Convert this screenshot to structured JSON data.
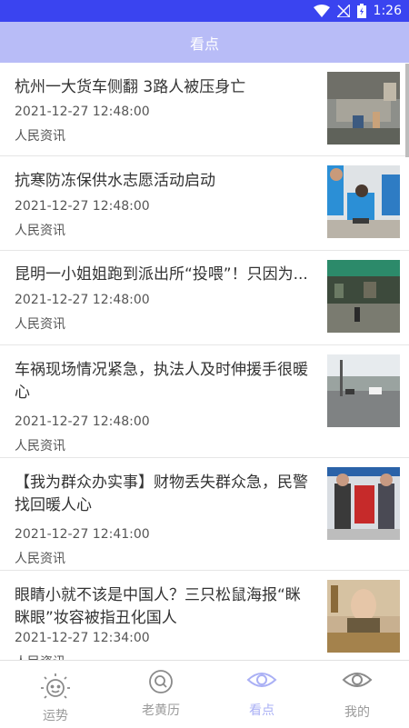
{
  "status_bar": {
    "time": "1:26",
    "icons": [
      "wifi-icon",
      "no-signal-icon",
      "battery-icon"
    ]
  },
  "app_bar": {
    "title": "看点"
  },
  "news": [
    {
      "title": "杭州一大货车侧翻 3路人被压身亡",
      "time": "2021-12-27 12:48:00",
      "source": "人民资讯",
      "thumb": "accident-photo"
    },
    {
      "title": "抗寒防冻保供水志愿活动启动",
      "time": "2021-12-27 12:48:00",
      "source": "人民资讯",
      "thumb": "volunteers-photo"
    },
    {
      "title": "昆明一小姐姐跑到派出所“投喂”！只因为...",
      "time": "2021-12-27 12:48:00",
      "source": "人民资讯",
      "thumb": "police-station-photo"
    },
    {
      "title": "车祸现场情况紧急，执法人及时伸援手很暖心",
      "time": "2021-12-27 12:48:00",
      "source": "人民资讯",
      "thumb": "road-photo"
    },
    {
      "title": "【我为群众办实事】财物丢失群众急，民警找回暖人心",
      "time": "2021-12-27 12:41:00",
      "source": "人民资讯",
      "thumb": "banner-photo"
    },
    {
      "title": "眼睛小就不该是中国人？三只松鼠海报“眯眯眼”妆容被指丑化国人",
      "time": "2021-12-27 12:34:00",
      "source": "人民资讯",
      "thumb": "poster-photo"
    }
  ],
  "tabs": [
    {
      "label": "运势",
      "icon": "sun-face-icon",
      "active": false
    },
    {
      "label": "老黄历",
      "icon": "search-icon",
      "active": false
    },
    {
      "label": "看点",
      "icon": "eye-icon",
      "active": true
    },
    {
      "label": "我的",
      "icon": "eye-icon",
      "active": false
    }
  ],
  "colors": {
    "status_bar": "#3a44f0",
    "app_bar": "#b8bcf7",
    "active_tab": "#aab0f5",
    "inactive_tab": "#9a9a9a"
  }
}
